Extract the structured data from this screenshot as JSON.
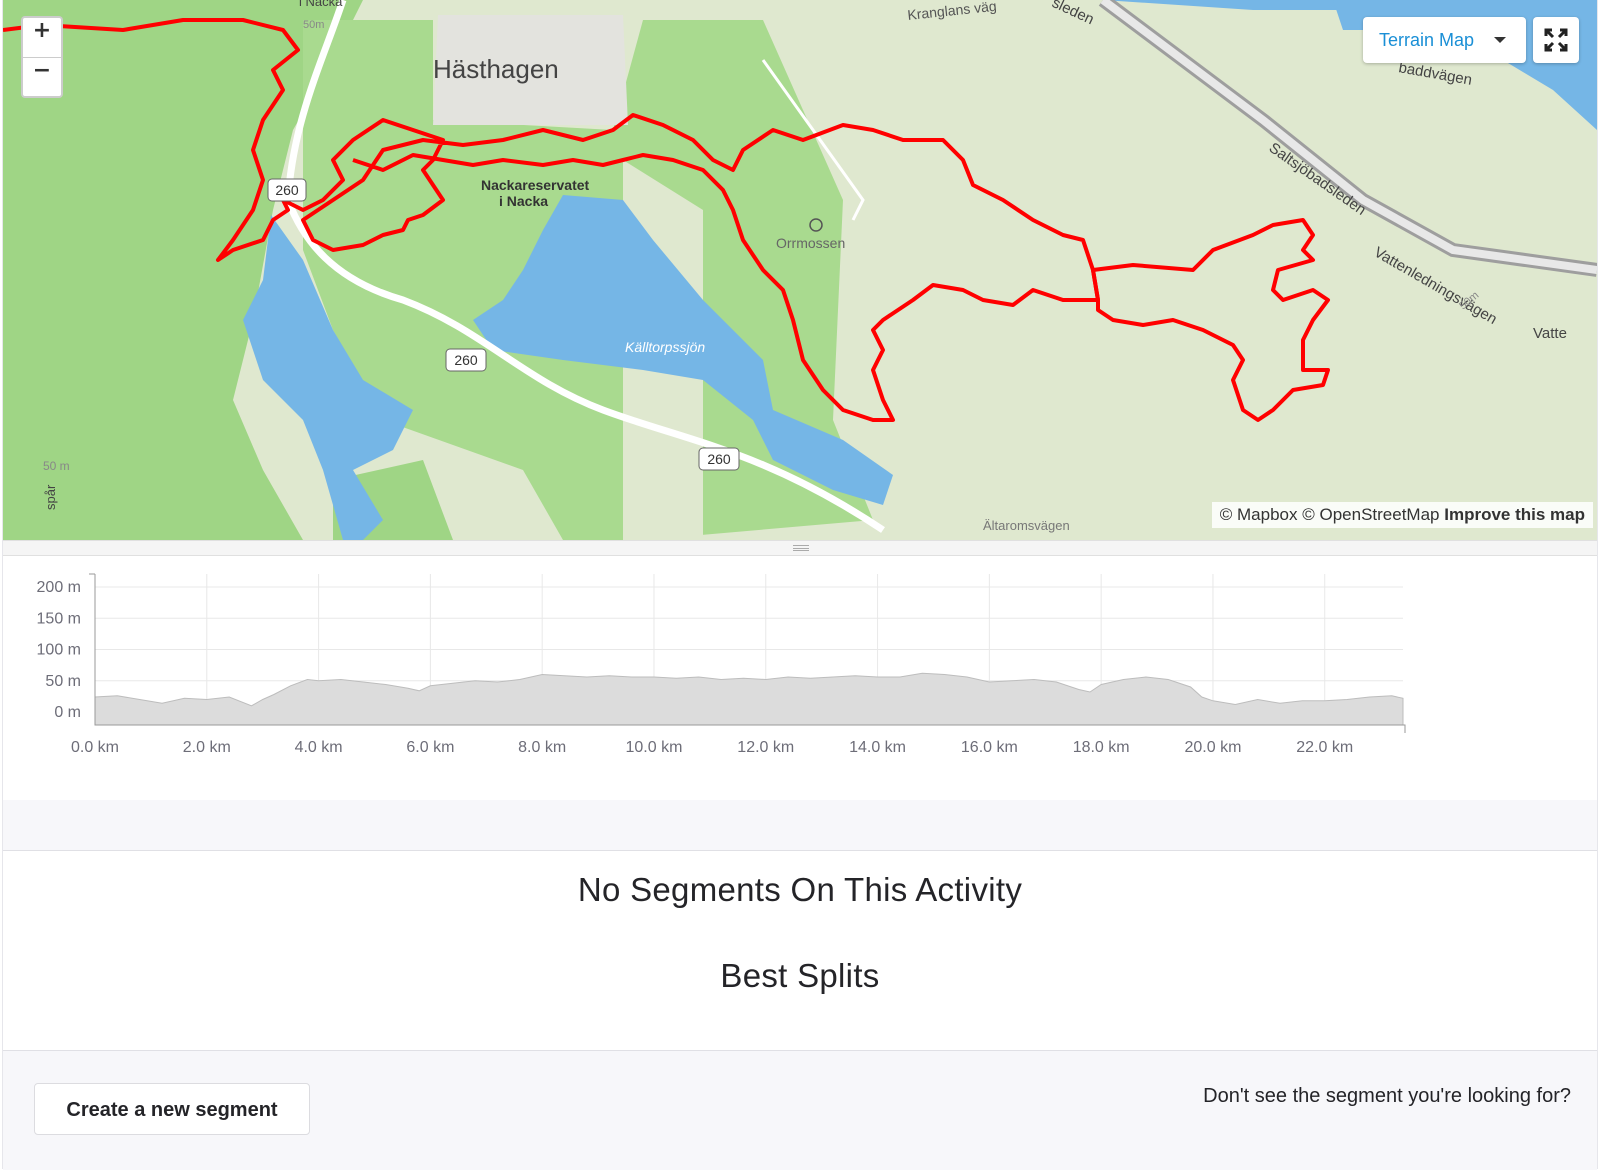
{
  "map": {
    "zoom_in": "+",
    "zoom_out": "−",
    "map_type": "Terrain Map",
    "attribution": {
      "mapbox": "© Mapbox",
      "osm": "© OpenStreetMap",
      "improve": "Improve this map"
    },
    "labels": {
      "town": "Hästhagen",
      "reserve_line1": "Nackareservatet",
      "reserve_line2": "i Nacka",
      "lake": "Källtorpssjön",
      "bog": "Orrmossen",
      "road1": "Kranglans väg",
      "road2": "Saltsjöbadsleden",
      "road3": "Vattenledningsvägen",
      "road4": "Vatte",
      "road5": "sleden",
      "road6": "baddvägen",
      "road7": "i Nacka",
      "road8": "spår",
      "road9": "Ältaromsvägen",
      "route_shield": "260",
      "contour_50": "50m",
      "contour_50_sp": "50 m"
    },
    "colors": {
      "route": "#ff0000",
      "water": "#75b6e6",
      "forest": "#9fd585",
      "open": "#dfe8cf",
      "accent": "#1a8fd6"
    }
  },
  "chart_data": {
    "type": "area",
    "title": "",
    "xlabel": "",
    "ylabel": "",
    "x_unit": "km",
    "y_unit": "m",
    "xlim": [
      0,
      23.4
    ],
    "ylim": [
      -20,
      200
    ],
    "x_ticks": [
      "0.0 km",
      "2.0 km",
      "4.0 km",
      "6.0 km",
      "8.0 km",
      "10.0 km",
      "12.0 km",
      "14.0 km",
      "16.0 km",
      "18.0 km",
      "20.0 km",
      "22.0 km"
    ],
    "y_ticks": [
      "200 m",
      "150 m",
      "100 m",
      "50 m",
      "0 m"
    ],
    "grid": true,
    "series": [
      {
        "x": [
          0,
          0.4,
          0.8,
          1.2,
          1.6,
          2.0,
          2.4,
          2.8,
          3.0,
          3.2,
          3.5,
          3.8,
          4.0,
          4.4,
          4.8,
          5.2,
          5.6,
          5.8,
          6.0,
          6.4,
          6.8,
          7.2,
          7.6,
          8.0,
          8.4,
          8.8,
          9.2,
          9.6,
          10.0,
          10.4,
          10.8,
          11.2,
          11.6,
          12.0,
          12.4,
          12.8,
          13.2,
          13.6,
          14.0,
          14.4,
          14.8,
          15.2,
          15.6,
          16.0,
          16.4,
          16.8,
          17.2,
          17.6,
          17.8,
          18.0,
          18.4,
          18.8,
          19.2,
          19.6,
          19.8,
          20.0,
          20.4,
          20.8,
          21.2,
          21.6,
          22.0,
          22.4,
          22.8,
          23.2,
          23.4
        ],
        "y": [
          24,
          26,
          20,
          14,
          22,
          20,
          24,
          10,
          20,
          28,
          42,
          52,
          50,
          52,
          48,
          44,
          38,
          34,
          42,
          46,
          50,
          48,
          52,
          60,
          58,
          56,
          58,
          56,
          56,
          54,
          56,
          52,
          54,
          52,
          56,
          54,
          56,
          58,
          56,
          56,
          62,
          60,
          56,
          48,
          50,
          52,
          48,
          36,
          32,
          44,
          52,
          56,
          52,
          40,
          24,
          18,
          12,
          20,
          14,
          18,
          18,
          20,
          24,
          26,
          22
        ]
      }
    ]
  },
  "segments": {
    "no_segments": "No Segments On This Activity",
    "best_splits": "Best Splits"
  },
  "footer": {
    "create_button": "Create a new segment",
    "question": "Don't see the segment you're looking for?"
  }
}
